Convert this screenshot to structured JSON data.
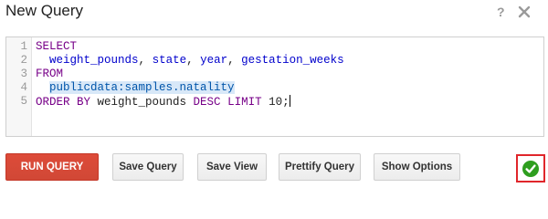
{
  "dialog": {
    "title": "New Query",
    "help_symbol": "?",
    "close_icon": "close-icon"
  },
  "editor": {
    "line_numbers": [
      "1",
      "2",
      "3",
      "4",
      "5"
    ],
    "lines": [
      {
        "tokens": [
          {
            "text": "SELECT",
            "kind": "keyword"
          }
        ]
      },
      {
        "tokens": [
          {
            "text": "  ",
            "kind": "plain"
          },
          {
            "text": "weight_pounds",
            "kind": "variable"
          },
          {
            "text": ", ",
            "kind": "plain"
          },
          {
            "text": "state",
            "kind": "variable"
          },
          {
            "text": ", ",
            "kind": "plain"
          },
          {
            "text": "year",
            "kind": "variable"
          },
          {
            "text": ", ",
            "kind": "plain"
          },
          {
            "text": "gestation_weeks",
            "kind": "variable"
          }
        ]
      },
      {
        "tokens": [
          {
            "text": "FROM",
            "kind": "keyword"
          }
        ]
      },
      {
        "tokens": [
          {
            "text": "  ",
            "kind": "plain"
          },
          {
            "text": "publicdata:samples.natality",
            "kind": "table"
          }
        ]
      },
      {
        "tokens": [
          {
            "text": "ORDER BY",
            "kind": "keyword"
          },
          {
            "text": " weight_pounds ",
            "kind": "plain"
          },
          {
            "text": "DESC",
            "kind": "keyword"
          },
          {
            "text": " ",
            "kind": "plain"
          },
          {
            "text": "LIMIT",
            "kind": "keyword"
          },
          {
            "text": " 10;",
            "kind": "plain"
          }
        ]
      }
    ]
  },
  "buttons": {
    "run_query": "RUN QUERY",
    "save_query": "Save Query",
    "save_view": "Save View",
    "prettify_query": "Prettify Query",
    "show_options": "Show Options"
  },
  "status": {
    "icon": "check-circle-icon",
    "color": "#2e9e1f",
    "highlight_color": "#e0262b"
  },
  "colors": {
    "run_button": "#d14836",
    "keyword": "#770088",
    "variable": "#0000cc",
    "table_highlight": "#d8e8f8"
  }
}
